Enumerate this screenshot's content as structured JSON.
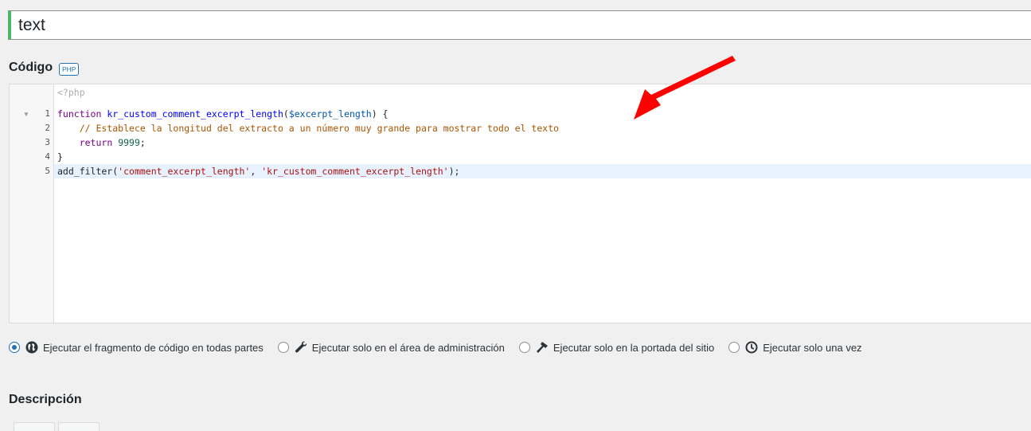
{
  "snippet": {
    "title_value": "text"
  },
  "code_section": {
    "label": "Código",
    "badge": "PHP",
    "open_tag": "<?php",
    "line_numbers": [
      "1",
      "2",
      "3",
      "4",
      "5"
    ],
    "lines": [
      [
        {
          "t": "function",
          "c": "kw"
        },
        {
          "t": " "
        },
        {
          "t": "kr_custom_comment_excerpt_length",
          "c": "def"
        },
        {
          "t": "("
        },
        {
          "t": "$excerpt_length",
          "c": "var"
        },
        {
          "t": ") {"
        }
      ],
      [
        {
          "t": "    "
        },
        {
          "t": "// Establece la longitud del extracto a un número muy grande para mostrar todo el texto",
          "c": "cm"
        }
      ],
      [
        {
          "t": "    "
        },
        {
          "t": "return",
          "c": "kw"
        },
        {
          "t": " "
        },
        {
          "t": "9999",
          "c": "num"
        },
        {
          "t": ";"
        }
      ],
      [
        {
          "t": "}"
        }
      ],
      [
        {
          "t": "add_filter("
        },
        {
          "t": "'comment_excerpt_length'",
          "c": "str"
        },
        {
          "t": ", "
        },
        {
          "t": "'kr_custom_comment_excerpt_length'",
          "c": "str"
        },
        {
          "t": ");"
        }
      ]
    ]
  },
  "scope_options": [
    {
      "label": "Ejecutar el fragmento de código en todas partes",
      "icon": "globe-icon",
      "checked": true
    },
    {
      "label": "Ejecutar solo en el área de administración",
      "icon": "wrench-icon",
      "checked": false
    },
    {
      "label": "Ejecutar solo en la portada del sitio",
      "icon": "hammer-icon",
      "checked": false
    },
    {
      "label": "Ejecutar solo una vez",
      "icon": "clock-icon",
      "checked": false
    }
  ],
  "description_section": {
    "label": "Descripción"
  },
  "colors": {
    "accent": "#2271b1",
    "title_border": "#4ab866",
    "annotation_arrow": "#ff0000"
  }
}
